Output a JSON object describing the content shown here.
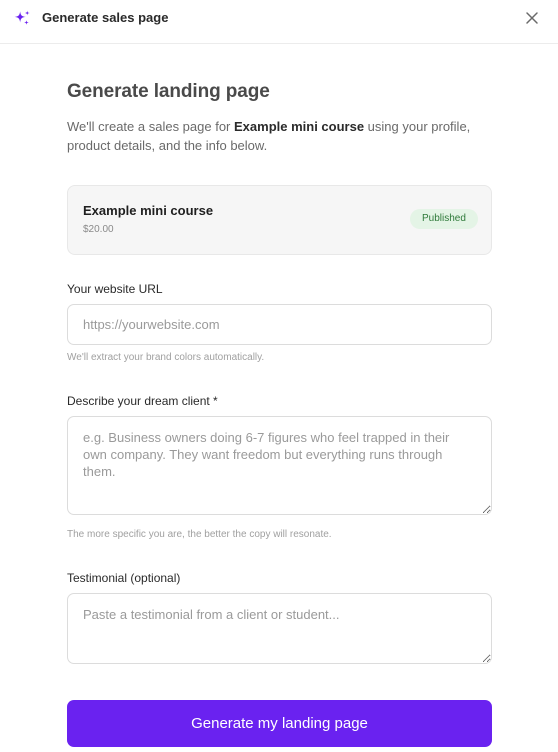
{
  "header": {
    "title": "Generate sales page",
    "sparkle_icon": "sparkles-icon",
    "close_icon": "close-icon",
    "accent_color": "#6a22f0"
  },
  "main": {
    "heading": "Generate landing page",
    "intro_prefix": "We'll create a sales page for ",
    "intro_product": "Example mini course",
    "intro_suffix": " using your profile, product details, and the info below."
  },
  "product": {
    "name": "Example mini course",
    "price": "$20.00",
    "status": "Published"
  },
  "form": {
    "website": {
      "label": "Your website URL",
      "placeholder": "https://yourwebsite.com",
      "value": "",
      "hint": "We'll extract your brand colors automatically."
    },
    "dream_client": {
      "label": "Describe your dream client *",
      "placeholder": "e.g. Business owners doing 6-7 figures who feel trapped in their own company. They want freedom but everything runs through them.",
      "value": "",
      "hint": "The more specific you are, the better the copy will resonate."
    },
    "testimonial": {
      "label": "Testimonial (optional)",
      "placeholder": "Paste a testimonial from a client or student...",
      "value": ""
    },
    "submit_label": "Generate my landing page"
  }
}
